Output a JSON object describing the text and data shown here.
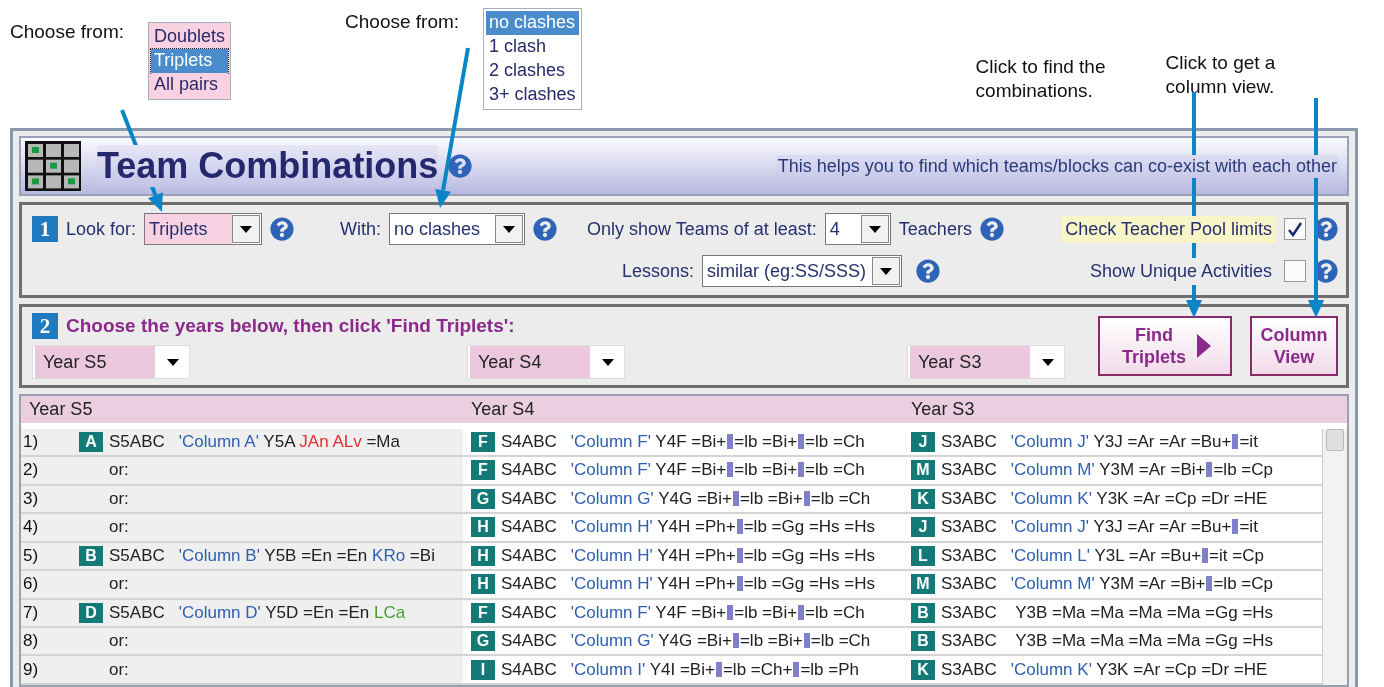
{
  "annotations": {
    "pickers": [
      {
        "label": "Choose from:",
        "color": "#f8d2e2",
        "options": [
          {
            "text": "Doublets",
            "selected": false
          },
          {
            "text": "Triplets",
            "selected": true
          },
          {
            "text": "All pairs",
            "selected": false
          }
        ]
      },
      {
        "label": "Choose from:",
        "color": "#ffffff",
        "options": [
          {
            "text": "no clashes",
            "selected": true
          },
          {
            "text": "1 clash",
            "selected": false
          },
          {
            "text": "2 clashes",
            "selected": false
          },
          {
            "text": "3+ clashes",
            "selected": false
          }
        ]
      }
    ],
    "notes": [
      "Click to find the combinations.",
      "Click to get a column view."
    ]
  },
  "header": {
    "title": "Team Combinations",
    "description": "This helps you to find which teams/blocks can co-exist with each other"
  },
  "section1": {
    "number": "1",
    "look_for": {
      "label": "Look for:",
      "value": "Triplets"
    },
    "with": {
      "label": "With:",
      "value": "no clashes"
    },
    "min_teachers": {
      "label": "Only show Teams of at least:",
      "value": "4",
      "suffix": "Teachers"
    },
    "lessons": {
      "label": "Lessons:",
      "value": "similar (eg:SS/SSS)"
    },
    "checks": [
      {
        "label": "Check Teacher Pool limits",
        "checked": true,
        "highlighted": true
      },
      {
        "label": "Show Unique Activities",
        "checked": false,
        "highlighted": false
      }
    ]
  },
  "section2": {
    "number": "2",
    "instruction": "Choose the years below, then click 'Find Triplets':",
    "years": [
      "Year S5",
      "Year S4",
      "Year S3"
    ],
    "buttons": [
      {
        "label": "Find Triplets",
        "kind": "find"
      },
      {
        "label": "Column View",
        "kind": "view"
      }
    ]
  },
  "results": {
    "columns": [
      "Year S5",
      "Year S4",
      "Year S3"
    ],
    "rows": [
      {
        "number": "1)",
        "cells": [
          {
            "kind": "entry",
            "badge": "A",
            "parts": [
              {
                "kind": "code",
                "text": "S5ABC"
              },
              {
                "kind": "column",
                "text": "'Column A'"
              },
              {
                "kind": "plain",
                "text": " Y5A "
              },
              {
                "kind": "red",
                "text": "JAn ALv"
              },
              {
                "kind": "plain",
                "text": " =Ma"
              }
            ]
          },
          {
            "kind": "entry",
            "badge": "F",
            "parts": [
              {
                "kind": "code",
                "text": "S4ABC"
              },
              {
                "kind": "column",
                "text": "'Column F'"
              },
              {
                "kind": "plain",
                "text": " Y4F =Bi+"
              },
              {
                "kind": "bar"
              },
              {
                "kind": "plain",
                "text": "=lb =Bi+"
              },
              {
                "kind": "bar"
              },
              {
                "kind": "plain",
                "text": "=lb =Ch"
              }
            ]
          },
          {
            "kind": "entry",
            "badge": "J",
            "parts": [
              {
                "kind": "code",
                "text": "S3ABC"
              },
              {
                "kind": "column",
                "text": "'Column J'"
              },
              {
                "kind": "plain",
                "text": " Y3J =Ar =Ar =Bu+"
              },
              {
                "kind": "bar"
              },
              {
                "kind": "plain",
                "text": "=it"
              }
            ]
          }
        ]
      },
      {
        "number": "2)",
        "cells": [
          {
            "kind": "or",
            "text": "or:"
          },
          {
            "kind": "entry",
            "badge": "F",
            "parts": [
              {
                "kind": "code",
                "text": "S4ABC"
              },
              {
                "kind": "column",
                "text": "'Column F'"
              },
              {
                "kind": "plain",
                "text": " Y4F =Bi+"
              },
              {
                "kind": "bar"
              },
              {
                "kind": "plain",
                "text": "=lb =Bi+"
              },
              {
                "kind": "bar"
              },
              {
                "kind": "plain",
                "text": "=lb =Ch"
              }
            ]
          },
          {
            "kind": "entry",
            "badge": "M",
            "parts": [
              {
                "kind": "code",
                "text": "S3ABC"
              },
              {
                "kind": "column",
                "text": "'Column M'"
              },
              {
                "kind": "plain",
                "text": " Y3M =Ar =Bi+"
              },
              {
                "kind": "bar"
              },
              {
                "kind": "plain",
                "text": "=lb =Cp"
              }
            ]
          }
        ]
      },
      {
        "number": "3)",
        "cells": [
          {
            "kind": "or",
            "text": "or:"
          },
          {
            "kind": "entry",
            "badge": "G",
            "parts": [
              {
                "kind": "code",
                "text": "S4ABC"
              },
              {
                "kind": "column",
                "text": "'Column G'"
              },
              {
                "kind": "plain",
                "text": " Y4G =Bi+"
              },
              {
                "kind": "bar"
              },
              {
                "kind": "plain",
                "text": "=lb =Bi+"
              },
              {
                "kind": "bar"
              },
              {
                "kind": "plain",
                "text": "=lb =Ch"
              }
            ]
          },
          {
            "kind": "entry",
            "badge": "K",
            "parts": [
              {
                "kind": "code",
                "text": "S3ABC"
              },
              {
                "kind": "column",
                "text": "'Column K'"
              },
              {
                "kind": "plain",
                "text": " Y3K =Ar =Cp =Dr =HE"
              }
            ]
          }
        ]
      },
      {
        "number": "4)",
        "cells": [
          {
            "kind": "or",
            "text": "or:"
          },
          {
            "kind": "entry",
            "badge": "H",
            "parts": [
              {
                "kind": "code",
                "text": "S4ABC"
              },
              {
                "kind": "column",
                "text": "'Column H'"
              },
              {
                "kind": "plain",
                "text": " Y4H =Ph+"
              },
              {
                "kind": "bar"
              },
              {
                "kind": "plain",
                "text": "=lb =Gg =Hs =Hs"
              }
            ]
          },
          {
            "kind": "entry",
            "badge": "J",
            "parts": [
              {
                "kind": "code",
                "text": "S3ABC"
              },
              {
                "kind": "column",
                "text": "'Column J'"
              },
              {
                "kind": "plain",
                "text": " Y3J =Ar =Ar =Bu+"
              },
              {
                "kind": "bar"
              },
              {
                "kind": "plain",
                "text": "=it"
              }
            ]
          }
        ]
      },
      {
        "number": "5)",
        "cells": [
          {
            "kind": "entry",
            "badge": "B",
            "parts": [
              {
                "kind": "code",
                "text": "S5ABC"
              },
              {
                "kind": "column",
                "text": "'Column B'"
              },
              {
                "kind": "plain",
                "text": " Y5B =En =En "
              },
              {
                "kind": "blue",
                "text": "KRo"
              },
              {
                "kind": "plain",
                "text": " =Bi"
              }
            ]
          },
          {
            "kind": "entry",
            "badge": "H",
            "parts": [
              {
                "kind": "code",
                "text": "S4ABC"
              },
              {
                "kind": "column",
                "text": "'Column H'"
              },
              {
                "kind": "plain",
                "text": " Y4H =Ph+"
              },
              {
                "kind": "bar"
              },
              {
                "kind": "plain",
                "text": "=lb =Gg =Hs =Hs"
              }
            ]
          },
          {
            "kind": "entry",
            "badge": "L",
            "parts": [
              {
                "kind": "code",
                "text": "S3ABC"
              },
              {
                "kind": "column",
                "text": "'Column L'"
              },
              {
                "kind": "plain",
                "text": " Y3L =Ar =Bu+"
              },
              {
                "kind": "bar"
              },
              {
                "kind": "plain",
                "text": "=it =Cp"
              }
            ]
          }
        ]
      },
      {
        "number": "6)",
        "cells": [
          {
            "kind": "or",
            "text": "or:"
          },
          {
            "kind": "entry",
            "badge": "H",
            "parts": [
              {
                "kind": "code",
                "text": "S4ABC"
              },
              {
                "kind": "column",
                "text": "'Column H'"
              },
              {
                "kind": "plain",
                "text": " Y4H =Ph+"
              },
              {
                "kind": "bar"
              },
              {
                "kind": "plain",
                "text": "=lb =Gg =Hs =Hs"
              }
            ]
          },
          {
            "kind": "entry",
            "badge": "M",
            "parts": [
              {
                "kind": "code",
                "text": "S3ABC"
              },
              {
                "kind": "column",
                "text": "'Column M'"
              },
              {
                "kind": "plain",
                "text": " Y3M =Ar =Bi+"
              },
              {
                "kind": "bar"
              },
              {
                "kind": "plain",
                "text": "=lb =Cp"
              }
            ]
          }
        ]
      },
      {
        "number": "7)",
        "cells": [
          {
            "kind": "entry",
            "badge": "D",
            "parts": [
              {
                "kind": "code",
                "text": "S5ABC"
              },
              {
                "kind": "column",
                "text": "'Column D'"
              },
              {
                "kind": "plain",
                "text": " Y5D =En =En "
              },
              {
                "kind": "green",
                "text": "LCa"
              }
            ]
          },
          {
            "kind": "entry",
            "badge": "F",
            "parts": [
              {
                "kind": "code",
                "text": "S4ABC"
              },
              {
                "kind": "column",
                "text": "'Column F'"
              },
              {
                "kind": "plain",
                "text": " Y4F =Bi+"
              },
              {
                "kind": "bar"
              },
              {
                "kind": "plain",
                "text": "=lb =Bi+"
              },
              {
                "kind": "bar"
              },
              {
                "kind": "plain",
                "text": "=lb =Ch"
              }
            ]
          },
          {
            "kind": "entry",
            "badge": "B",
            "parts": [
              {
                "kind": "code",
                "text": "S3ABC"
              },
              {
                "kind": "plain",
                "text": " Y3B =Ma =Ma =Ma =Ma =Gg =Hs"
              }
            ]
          }
        ]
      },
      {
        "number": "8)",
        "cells": [
          {
            "kind": "or",
            "text": "or:"
          },
          {
            "kind": "entry",
            "badge": "G",
            "parts": [
              {
                "kind": "code",
                "text": "S4ABC"
              },
              {
                "kind": "column",
                "text": "'Column G'"
              },
              {
                "kind": "plain",
                "text": " Y4G =Bi+"
              },
              {
                "kind": "bar"
              },
              {
                "kind": "plain",
                "text": "=lb =Bi+"
              },
              {
                "kind": "bar"
              },
              {
                "kind": "plain",
                "text": "=lb =Ch"
              }
            ]
          },
          {
            "kind": "entry",
            "badge": "B",
            "parts": [
              {
                "kind": "code",
                "text": "S3ABC"
              },
              {
                "kind": "plain",
                "text": " Y3B =Ma =Ma =Ma =Ma =Gg =Hs"
              }
            ]
          }
        ]
      },
      {
        "number": "9)",
        "cells": [
          {
            "kind": "or",
            "text": "or:"
          },
          {
            "kind": "entry",
            "badge": "I",
            "parts": [
              {
                "kind": "code",
                "text": "S4ABC"
              },
              {
                "kind": "column",
                "text": "'Column I'"
              },
              {
                "kind": "plain",
                "text": " Y4I =Bi+"
              },
              {
                "kind": "bar"
              },
              {
                "kind": "plain",
                "text": "=lb =Ch+"
              },
              {
                "kind": "bar"
              },
              {
                "kind": "plain",
                "text": "=lb =Ph"
              }
            ]
          },
          {
            "kind": "entry",
            "badge": "K",
            "parts": [
              {
                "kind": "code",
                "text": "S3ABC"
              },
              {
                "kind": "column",
                "text": "'Column K'"
              },
              {
                "kind": "plain",
                "text": " Y3K =Ar =Cp =Dr =HE"
              }
            ]
          }
        ]
      }
    ]
  }
}
